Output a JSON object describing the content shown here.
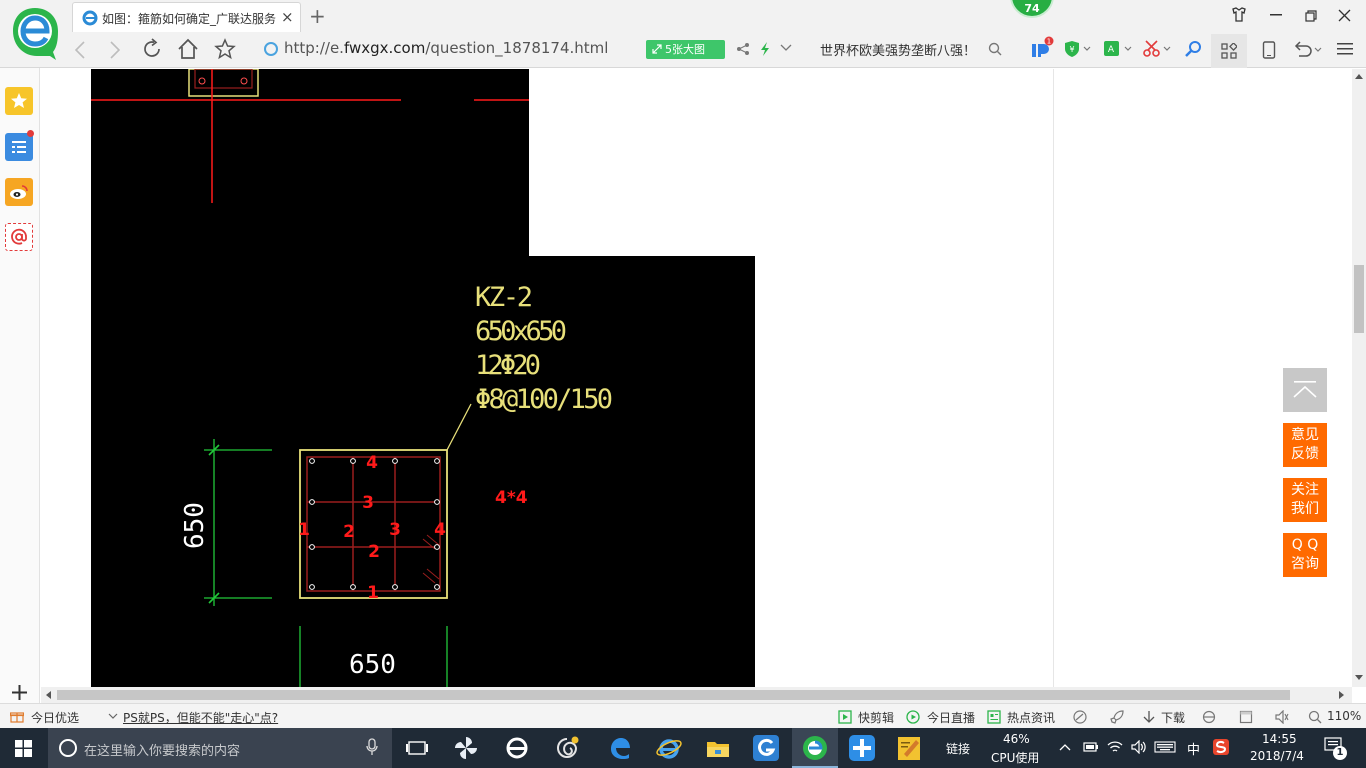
{
  "browser": {
    "tab_title": "如图：箍筋如何确定_广联达服务",
    "close_glyph": "×",
    "newtab_glyph": "+",
    "badge_count": "74",
    "url_prefix": "http://e.",
    "url_domain": "fwxgx.com",
    "url_path": "/question_1878174.html",
    "big_image_label": "5张大图",
    "search_suggestion": "世界杯欧美强势垄断八强！",
    "toolbar_badge": "1"
  },
  "page": {
    "feedback_label_1": "意见",
    "feedback_label_2": "反馈",
    "follow_label_1": "关注",
    "follow_label_2": "我们",
    "qq_label_1": "Q Q",
    "qq_label_2": "咨询"
  },
  "cad_drawing": {
    "title": "KZ-2",
    "size": "650x650",
    "main_rebar": "12Φ20",
    "stirrup": "Φ8@100/150",
    "dim_vertical": "650",
    "dim_horizontal": "650",
    "annotation": "4*4",
    "grid_numbers": [
      "4",
      "3",
      "1",
      "2",
      "3",
      "4",
      "2",
      "1"
    ],
    "colors": {
      "background": "#000000",
      "outline": "#e8e07a",
      "red": "#ff1a1a",
      "green": "#22c83a",
      "darkred": "#9a1e1e"
    }
  },
  "statusbar": {
    "today_picks": "今日优选",
    "headline": "PS就PS，但能不能\"走心\"点?",
    "quick_clip": "快剪辑",
    "live": "今日直播",
    "hot_news": "热点资讯",
    "download": "下载",
    "zoom": "110%"
  },
  "taskbar": {
    "search_placeholder": "在这里输入你要搜索的内容",
    "links_label": "链接",
    "cpu_percent": "46%",
    "cpu_label": "CPU使用",
    "ime": "中",
    "time": "14:55",
    "date": "2018/7/4",
    "notification_count": "1"
  }
}
